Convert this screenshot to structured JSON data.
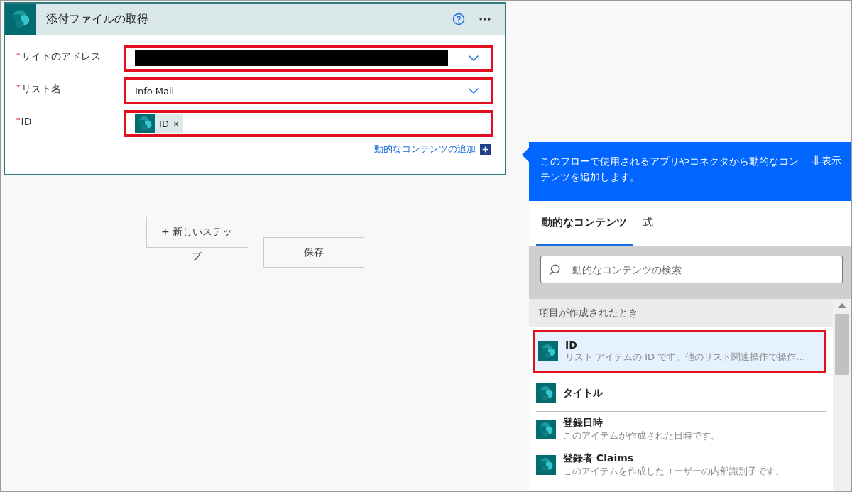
{
  "card": {
    "title": "添付ファイルの取得",
    "fields": [
      {
        "label": "サイトのアドレス",
        "required_mark": "*",
        "kind": "dropdown",
        "redacted": true,
        "highlighted": true
      },
      {
        "label": "リスト名",
        "required_mark": "*",
        "kind": "dropdown",
        "value": "Info Mail",
        "highlighted": true
      },
      {
        "label": "ID",
        "required_mark": "*",
        "kind": "tokens",
        "tokens": [
          {
            "label": "ID",
            "remove": "×"
          }
        ],
        "highlighted": true
      }
    ],
    "add_dynamic_link": "動的なコンテンツの追加"
  },
  "actions": {
    "new_step": "+ 新しいステップ",
    "save": "保存"
  },
  "panel": {
    "description": "このフローで使用されるアプリやコネクタから動的なコンテンツを追加します。",
    "hide": "非表示",
    "tabs": [
      {
        "label": "動的なコンテンツ",
        "selected": true
      },
      {
        "label": "式",
        "selected": false
      }
    ],
    "search": {
      "placeholder": "動的なコンテンツの検索"
    },
    "section": "項目が作成されたとき",
    "items": [
      {
        "title": "ID",
        "description": "リスト アイテムの ID です。他のリスト関連操作で操作…",
        "selected": true,
        "highlighted": true
      },
      {
        "title": "タイトル",
        "selected": false,
        "highlighted": false
      },
      {
        "title": "登録日時",
        "description": "このアイテムが作成された日時です。",
        "selected": false,
        "highlighted": false
      },
      {
        "title": "登録者 Claims",
        "description": "このアイテムを作成したユーザーの内部識別子です。",
        "selected": false,
        "highlighted": false
      }
    ]
  }
}
